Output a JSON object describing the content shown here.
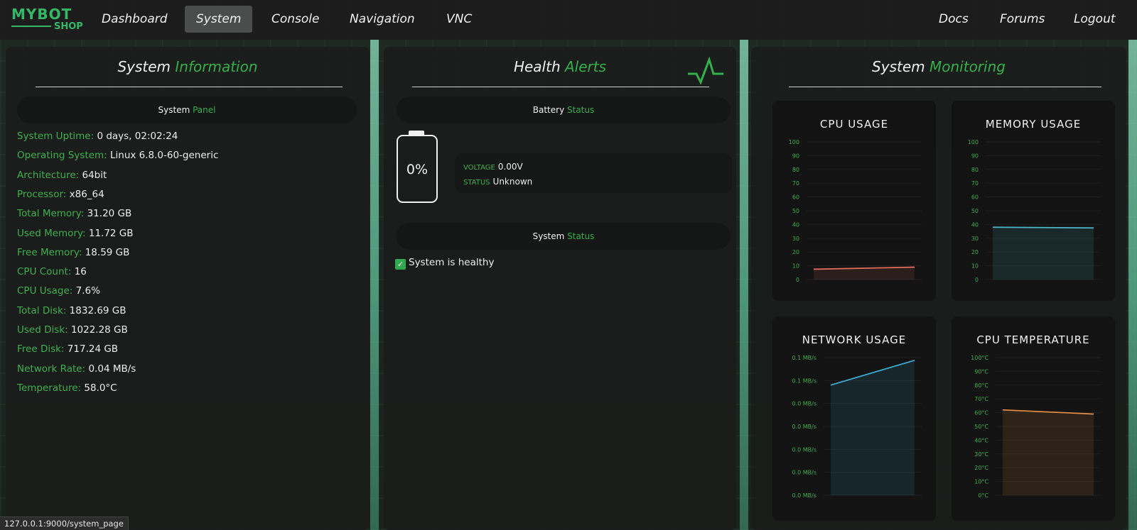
{
  "nav": {
    "logo_main": "MYBOT",
    "logo_sub": "SHOP",
    "items": [
      "Dashboard",
      "System",
      "Console",
      "Navigation",
      "VNC"
    ],
    "active": "System",
    "right_items": [
      "Docs",
      "Forums",
      "Logout"
    ]
  },
  "system_info": {
    "title_a": "System",
    "title_b": "Information",
    "panel_a": "System",
    "panel_b": "Panel",
    "rows": [
      {
        "key": "System Uptime:",
        "value": "0 days, 02:02:24"
      },
      {
        "key": "Operating System:",
        "value": "Linux 6.8.0-60-generic"
      },
      {
        "key": "Architecture:",
        "value": "64bit"
      },
      {
        "key": "Processor:",
        "value": "x86_64"
      },
      {
        "key": "Total Memory:",
        "value": "31.20 GB"
      },
      {
        "key": "Used Memory:",
        "value": "11.72 GB"
      },
      {
        "key": "Free Memory:",
        "value": "18.59 GB"
      },
      {
        "key": "CPU Count:",
        "value": "16"
      },
      {
        "key": "CPU Usage:",
        "value": "7.6%"
      },
      {
        "key": "Total Disk:",
        "value": "1832.69 GB"
      },
      {
        "key": "Used Disk:",
        "value": "1022.28 GB"
      },
      {
        "key": "Free Disk:",
        "value": "717.24 GB"
      },
      {
        "key": "Network Rate:",
        "value": "0.04 MB/s"
      },
      {
        "key": "Temperature:",
        "value": "58.0°C"
      }
    ]
  },
  "health": {
    "title_a": "Health",
    "title_b": "Alerts",
    "battery_label_a": "Battery",
    "battery_label_b": "Status",
    "battery_percent": "0%",
    "voltage_key": "VOLTAGE",
    "voltage_value": "0.00V",
    "status_key": "STATUS",
    "status_value": "Unknown",
    "system_label_a": "System",
    "system_label_b": "Status",
    "healthy_text": "System is healthy"
  },
  "monitoring": {
    "title_a": "System",
    "title_b": "Monitoring"
  },
  "chart_data": [
    {
      "type": "area",
      "title": "CPU USAGE",
      "ylim": [
        0,
        100
      ],
      "yticks": [
        "100",
        "90",
        "80",
        "70",
        "60",
        "50",
        "40",
        "30",
        "20",
        "10",
        "0"
      ],
      "series": [
        {
          "values": [
            7.5,
            9
          ]
        }
      ],
      "color": "#e06a5a"
    },
    {
      "type": "area",
      "title": "MEMORY USAGE",
      "ylim": [
        0,
        100
      ],
      "yticks": [
        "100",
        "90",
        "80",
        "70",
        "60",
        "50",
        "40",
        "30",
        "20",
        "10",
        "0"
      ],
      "series": [
        {
          "values": [
            38,
            37.5
          ]
        }
      ],
      "color": "#4bb6cc"
    },
    {
      "type": "area",
      "title": "NETWORK USAGE",
      "ylim": [
        0,
        0.1
      ],
      "yticks": [
        "0.1 MB/s",
        "0.1 MB/s",
        "0.0 MB/s",
        "0.0 MB/s",
        "0.0 MB/s",
        "0.0 MB/s",
        "0.0 MB/s"
      ],
      "series": [
        {
          "values": [
            0.08,
            0.098
          ]
        }
      ],
      "color": "#3ba8d0"
    },
    {
      "type": "area",
      "title": "CPU TEMPERATURE",
      "ylim": [
        0,
        100
      ],
      "yticks": [
        "100°C",
        "90°C",
        "80°C",
        "70°C",
        "60°C",
        "50°C",
        "40°C",
        "30°C",
        "20°C",
        "10°C",
        "0°C"
      ],
      "series": [
        {
          "values": [
            62,
            59
          ]
        }
      ],
      "color": "#e08a45"
    }
  ],
  "status_bar": "127.0.0.1:9000/system_page"
}
